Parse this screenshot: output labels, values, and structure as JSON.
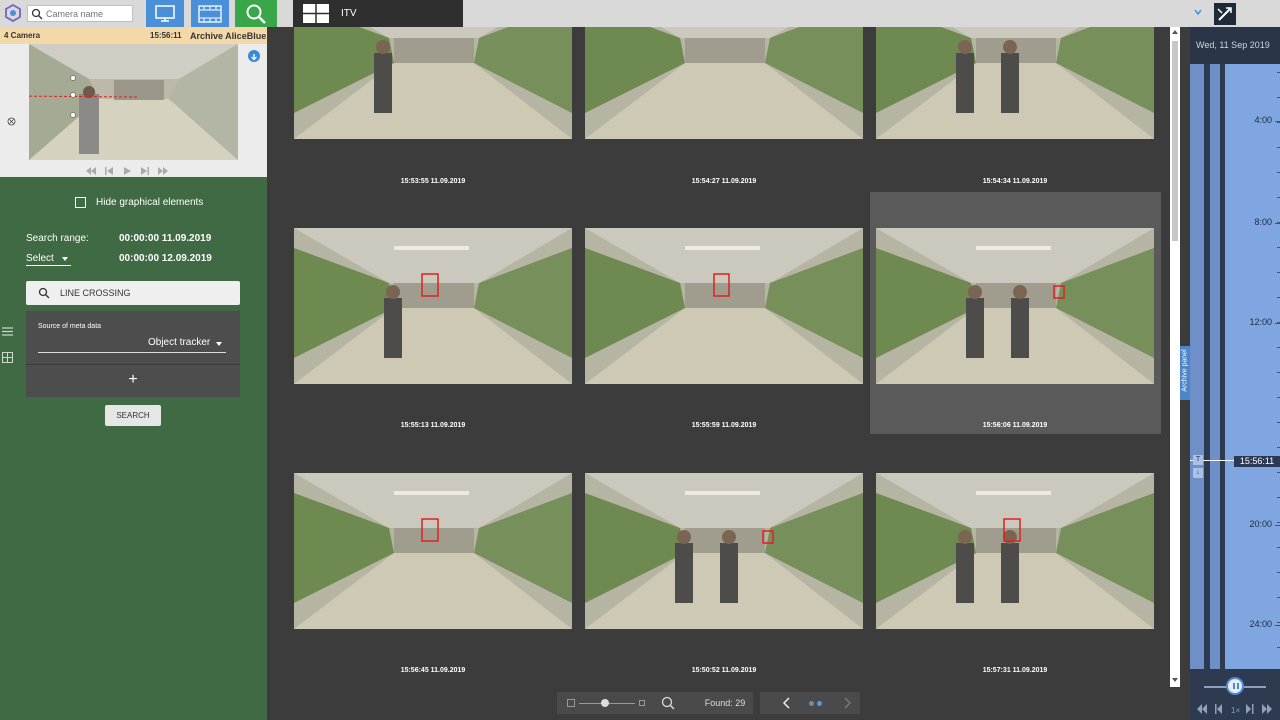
{
  "topbar": {
    "search_placeholder": "Camera name",
    "layout_name": "ITV"
  },
  "camera_panel": {
    "name": "4 Camera",
    "time": "15:56:11",
    "archive_label": "Archive AliceBlue"
  },
  "search_panel": {
    "hide_graphics_label": "Hide graphical elements",
    "range_label": "Search range:",
    "range_from": "00:00:00 11.09.2019",
    "select_label": "Select",
    "range_to": "00:00:00 12.09.2019",
    "search_type": "LINE CROSSING",
    "meta_source_label": "Source of meta data",
    "meta_source_value": "Object tracker",
    "add_label": "+",
    "search_button": "SEARCH"
  },
  "results": [
    {
      "timestamp": "15:53:55 11.09.2019",
      "people": 1,
      "selected": false
    },
    {
      "timestamp": "15:54:27 11.09.2019",
      "people": 0,
      "selected": false
    },
    {
      "timestamp": "15:54:34 11.09.2019",
      "people": 2,
      "selected": false
    },
    {
      "timestamp": "15:55:13 11.09.2019",
      "people": 1,
      "selected": false
    },
    {
      "timestamp": "15:55:59 11.09.2019",
      "people": 0,
      "selected": false
    },
    {
      "timestamp": "15:56:06 11.09.2019",
      "people": 2,
      "selected": true
    },
    {
      "timestamp": "15:56:45 11.09.2019",
      "people": 0,
      "selected": false
    },
    {
      "timestamp": "15:50:52 11.09.2019",
      "people": 2,
      "selected": false
    },
    {
      "timestamp": "15:57:31 11.09.2019",
      "people": 2,
      "selected": false
    }
  ],
  "bottombar": {
    "found_label": "Found: 29"
  },
  "timeline": {
    "date": "Wed, 11 Sep 2019",
    "ticks": [
      "4:00",
      "8:00",
      "12:00",
      "20:00",
      "24:00"
    ],
    "cursor_time": "15:56:11",
    "archive_panel_label": "Archive panel",
    "marker_top": "T",
    "marker_bottom": "↓"
  },
  "colors": {
    "left_panel": "#3f6a44",
    "accent_blue": "#4a90d9",
    "search_green": "#3aa64a",
    "detection_box": "#e02020",
    "camera_header": "#f3d9a8"
  }
}
